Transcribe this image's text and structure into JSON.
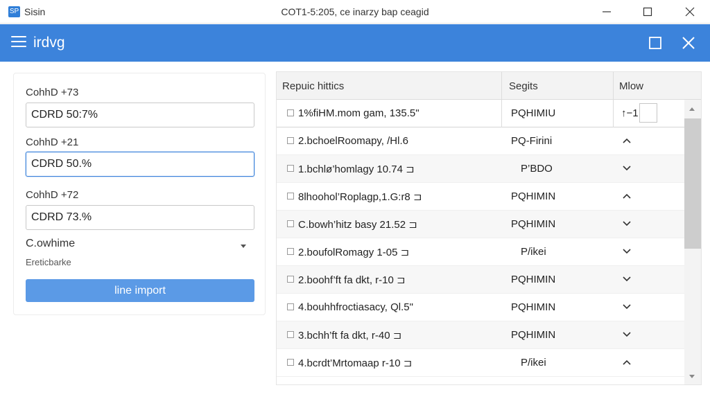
{
  "window": {
    "app_name": "Sisin",
    "title": "COT1-5:205, ce inarzy bap ceagid",
    "app_icon_glyph": "SP"
  },
  "header": {
    "title": "irdvg"
  },
  "form": {
    "field1": {
      "label": "CohhD +73",
      "value": "CDRD 50:7%"
    },
    "field2": {
      "label": "CohhD +21",
      "value": "CDRD 50.%"
    },
    "field3": {
      "label": "CohhD +72",
      "value": "CDRD 73.%"
    },
    "select": {
      "label": "C.owhime",
      "sub": "Ereticbarke"
    },
    "import_button": "line import"
  },
  "table": {
    "headers": [
      "Repuic hittics",
      "Segits",
      "Mlow"
    ],
    "first_row": {
      "name": "1%fiHM.mom gam, 135.5\"",
      "status": "PQHIMIU",
      "mlow": "↑−1"
    },
    "rows": [
      {
        "name": "2.bchoelRoomapy, /Hl.6",
        "status": "PQ-Firini",
        "chevron": "up"
      },
      {
        "name": "1.bchlø’homlagy 10.74 ⊐",
        "status": "P’BDO",
        "chevron": "down"
      },
      {
        "name": "8lhoohol’Roplagp,1.G:r8 ⊐",
        "status": "PQHIMIN",
        "chevron": "up"
      },
      {
        "name": "C.bowh’hitz basy 21.52 ⊐",
        "status": "PQHIMIN",
        "chevron": "down"
      },
      {
        "name": "2.boufolRomagy 1-05 ⊐",
        "status": "P/ikei",
        "chevron": "down"
      },
      {
        "name": "2.boohf’ft fa dkt, r-10 ⊐",
        "status": "PQHIMIN",
        "chevron": "down"
      },
      {
        "name": "4.bouhhfroctiasacy, Ql.5\"",
        "status": "PQHIMIN",
        "chevron": "down"
      },
      {
        "name": "3.bchh’ft fa dkt, r-40 ⊐",
        "status": "PQHIMIN",
        "chevron": "down"
      },
      {
        "name": "4.bcrdt’Mrtomaap r-10 ⊐",
        "status": "P/ikei",
        "chevron": "up"
      }
    ]
  },
  "colors": {
    "accent": "#3c83db",
    "button": "#5b9ae6"
  }
}
